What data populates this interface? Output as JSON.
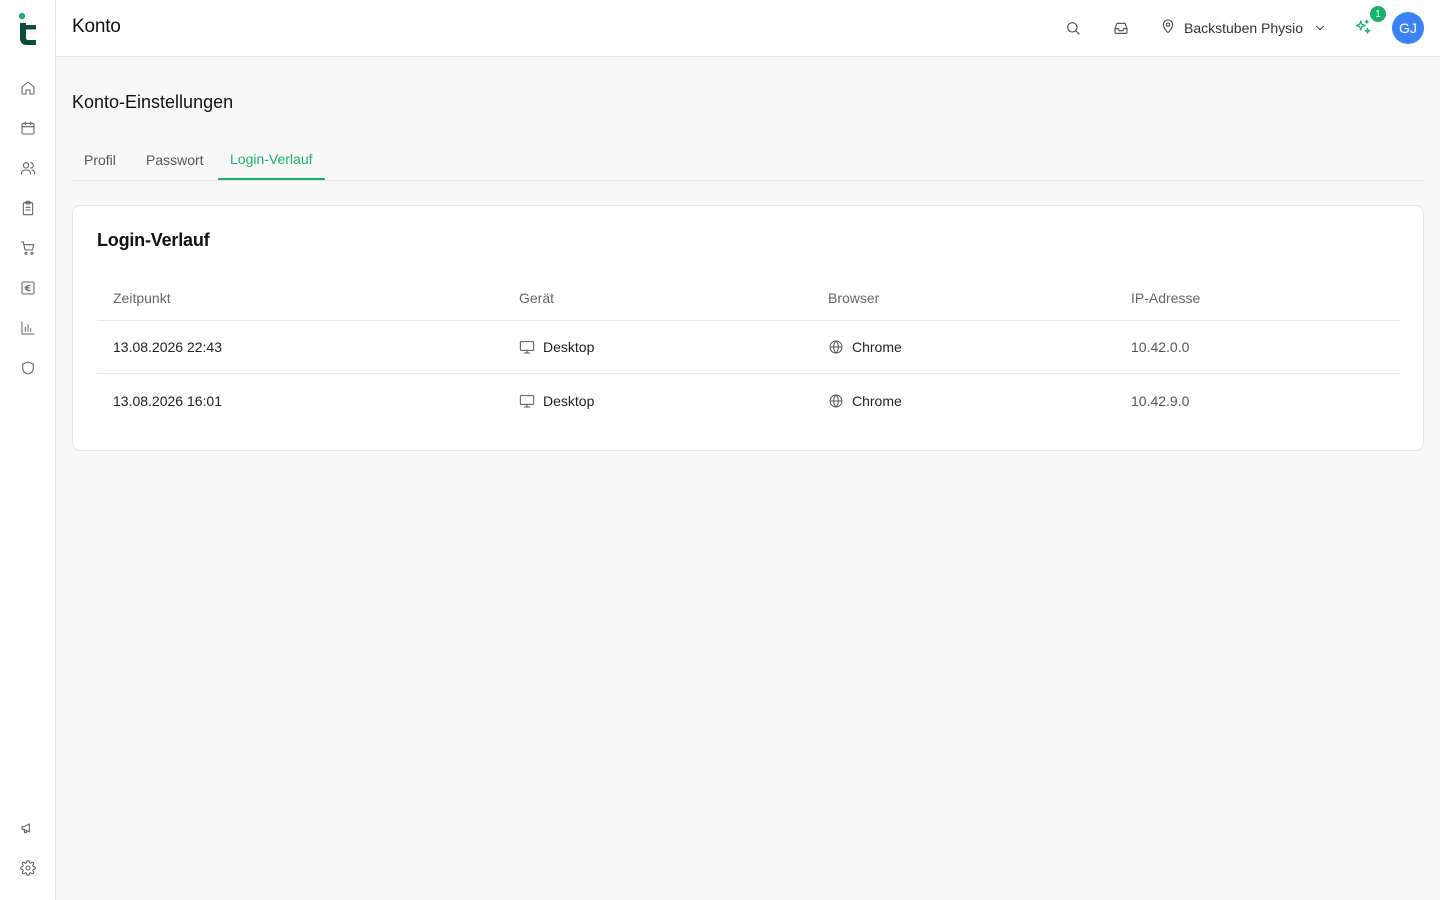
{
  "app": {
    "header_title": "Konto",
    "location": "Backstuben Physio",
    "notification_count": "1",
    "avatar_initials": "GJ",
    "accent_color": "#17b26a",
    "brand_color": "#0f4c3a",
    "avatar_color": "#3b82f6"
  },
  "sidebar": {
    "items": [
      {
        "icon": "home-icon"
      },
      {
        "icon": "calendar-icon"
      },
      {
        "icon": "users-icon"
      },
      {
        "icon": "clipboard-icon"
      },
      {
        "icon": "cart-icon"
      },
      {
        "icon": "euro-icon"
      },
      {
        "icon": "bar-chart-icon"
      },
      {
        "icon": "shield-icon"
      }
    ],
    "bottom_items": [
      {
        "icon": "megaphone-icon"
      },
      {
        "icon": "gear-icon"
      }
    ]
  },
  "page": {
    "title": "Konto-Einstellungen",
    "tabs": [
      {
        "label": "Profil",
        "active": false
      },
      {
        "label": "Passwort",
        "active": false
      },
      {
        "label": "Login-Verlauf",
        "active": true
      }
    ]
  },
  "login_history": {
    "title": "Login-Verlauf",
    "columns": [
      "Zeitpunkt",
      "Gerät",
      "Browser",
      "IP-Adresse"
    ],
    "rows": [
      {
        "time": "13.08.2026 22:43",
        "device": "Desktop",
        "browser": "Chrome",
        "ip": "10.42.0.0"
      },
      {
        "time": "13.08.2026 16:01",
        "device": "Desktop",
        "browser": "Chrome",
        "ip": "10.42.9.0"
      }
    ]
  }
}
